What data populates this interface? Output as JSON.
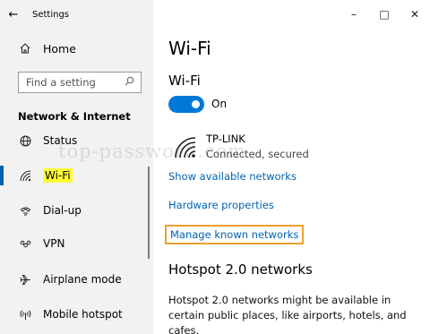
{
  "window": {
    "app_title": "Settings",
    "back_icon": "back-arrow-icon",
    "controls": {
      "minimize_glyph": "–",
      "maximize_glyph": "□",
      "close_glyph": "✕"
    }
  },
  "sidebar": {
    "home_label": "Home",
    "search_placeholder": "Find a setting",
    "section_header": "Network & Internet",
    "items": [
      {
        "label": "Status",
        "icon": "globe-icon",
        "selected": false
      },
      {
        "label": "Wi-Fi",
        "icon": "wifi-icon",
        "selected": true
      },
      {
        "label": "Dial-up",
        "icon": "phone-icon",
        "selected": false
      },
      {
        "label": "VPN",
        "icon": "vpn-icon",
        "selected": false
      },
      {
        "label": "Airplane mode",
        "icon": "airplane-icon",
        "selected": false
      },
      {
        "label": "Mobile hotspot",
        "icon": "hotspot-icon",
        "selected": false
      }
    ]
  },
  "watermark": "top-password.com",
  "main": {
    "page_title": "Wi-Fi",
    "wifi_subheader": "Wi-Fi",
    "toggle": {
      "state_label": "On",
      "on": true,
      "accent": "#0078d7"
    },
    "network": {
      "name": "TP-LINK",
      "status": "Connected, secured"
    },
    "links": {
      "show_available": "Show available networks",
      "hardware_properties": "Hardware properties",
      "manage_known": "Manage known networks"
    },
    "hotspot": {
      "title": "Hotspot 2.0 networks",
      "description": "Hotspot 2.0 networks might be available in certain public places, like airports, hotels, and cafes."
    }
  },
  "colors": {
    "link": "#0063b1",
    "highlight": "#ffff33",
    "focus_box": "#f0a030",
    "sidebar_bg": "#f2f2f2"
  }
}
